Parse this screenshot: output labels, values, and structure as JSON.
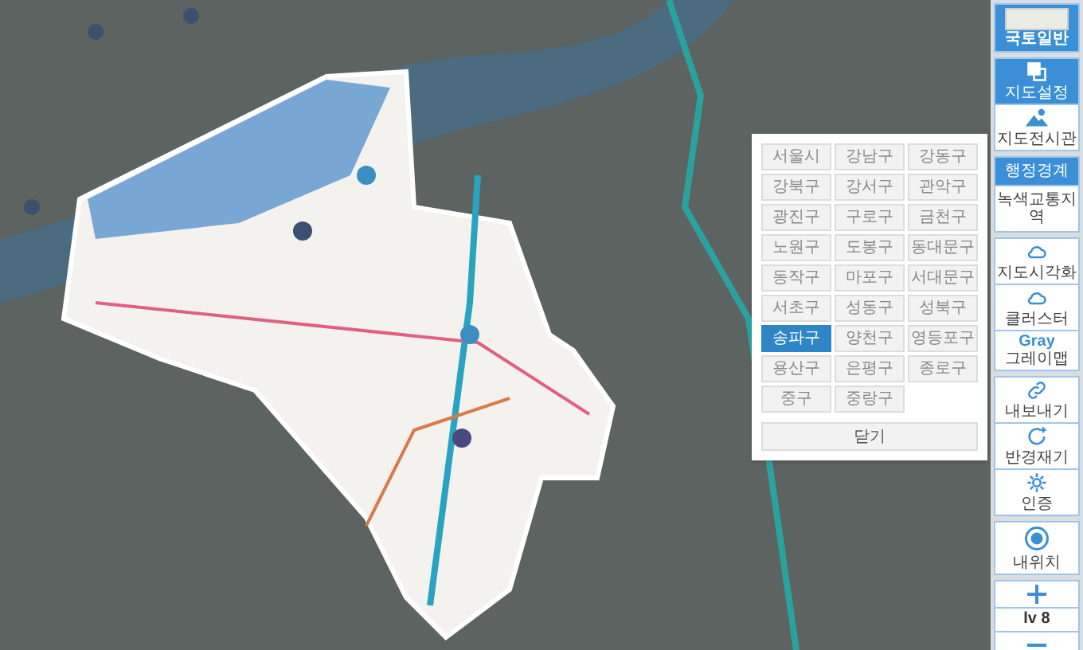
{
  "district_panel": {
    "districts": [
      {
        "label": "서울시",
        "selected": false
      },
      {
        "label": "강남구",
        "selected": false
      },
      {
        "label": "강동구",
        "selected": false
      },
      {
        "label": "강북구",
        "selected": false
      },
      {
        "label": "강서구",
        "selected": false
      },
      {
        "label": "관악구",
        "selected": false
      },
      {
        "label": "광진구",
        "selected": false
      },
      {
        "label": "구로구",
        "selected": false
      },
      {
        "label": "금천구",
        "selected": false
      },
      {
        "label": "노원구",
        "selected": false
      },
      {
        "label": "도봉구",
        "selected": false
      },
      {
        "label": "동대문구",
        "selected": false
      },
      {
        "label": "동작구",
        "selected": false
      },
      {
        "label": "마포구",
        "selected": false
      },
      {
        "label": "서대문구",
        "selected": false
      },
      {
        "label": "서초구",
        "selected": false
      },
      {
        "label": "성동구",
        "selected": false
      },
      {
        "label": "성북구",
        "selected": false
      },
      {
        "label": "송파구",
        "selected": true
      },
      {
        "label": "양천구",
        "selected": false
      },
      {
        "label": "영등포구",
        "selected": false
      },
      {
        "label": "용산구",
        "selected": false
      },
      {
        "label": "은평구",
        "selected": false
      },
      {
        "label": "종로구",
        "selected": false
      },
      {
        "label": "중구",
        "selected": false
      },
      {
        "label": "중랑구",
        "selected": false
      }
    ],
    "close_button": "닫기"
  },
  "toolbar": {
    "groups": [
      [
        {
          "kind": "basemap",
          "label": "국토일반",
          "selected": true
        }
      ],
      [
        {
          "kind": "icon",
          "label": "지도설정",
          "selected": true
        },
        {
          "kind": "icon",
          "label": "지도전시관",
          "selected": false
        }
      ],
      [
        {
          "kind": "text",
          "label": "행정경계",
          "selected": true
        },
        {
          "kind": "text",
          "label": "녹색교통지역",
          "selected": false
        }
      ],
      [
        {
          "kind": "icon",
          "label": "지도시각화",
          "selected": false
        },
        {
          "kind": "icon",
          "label": "클러스터",
          "selected": false
        },
        {
          "kind": "tag",
          "tag": "Gray",
          "label": "그레이맵",
          "selected": false
        }
      ],
      [
        {
          "kind": "icon",
          "label": "내보내기",
          "selected": false
        },
        {
          "kind": "icon",
          "label": "반경재기",
          "selected": false
        },
        {
          "kind": "icon",
          "label": "인증",
          "selected": false
        }
      ],
      [
        {
          "kind": "icon",
          "label": "내위치",
          "selected": false
        }
      ],
      [
        {
          "kind": "zoom_in"
        },
        {
          "kind": "level",
          "label": "lv 8"
        },
        {
          "kind": "zoom_out"
        }
      ]
    ]
  }
}
